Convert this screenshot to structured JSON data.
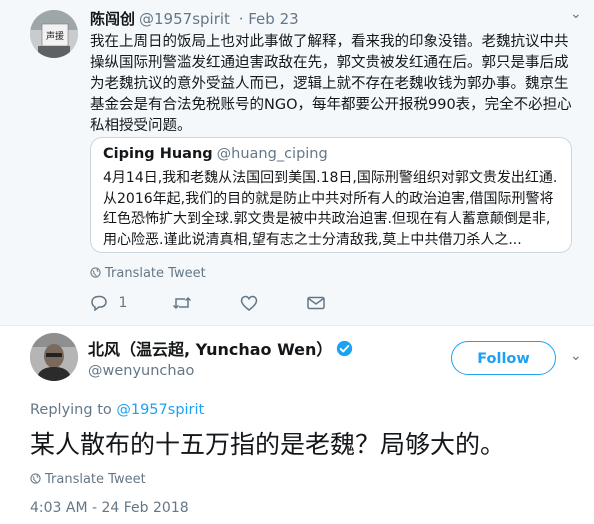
{
  "parent_tweet": {
    "name": "陈闯创",
    "handle": "@1957spirit",
    "time": "· Feb 23",
    "avatar_sign_text": "声援",
    "text": "我在上周日的饭局上也对此事做了解释，看来我的印象没错。老魏抗议中共操纵国际刑警滥发红通迫害政敌在先，郭文贵被发红通在后。郭只是事后成为老魏抗议的意外受益人而已，逻辑上就不存在老魏收钱为郭办事。魏京生基金会是有合法免税账号的NGO，每年都要公开报税990表，完全不必担心私相授受问题。",
    "quoted": {
      "name": "Ciping Huang",
      "handle": "@huang_ciping",
      "text": "4月14日,我和老魏从法国回到美国.18日,国际刑警组织对郭文贵发出红通.从2016年起,我们的目的就是防止中共对所有人的政治迫害,借国际刑警将红色恐怖扩大到全球.郭文贵是被中共政治迫害.但现在有人蓄意颠倒是非,用心险恶.谨此说清真相,望有志之士分清敌我,莫上中共借刀杀人之..."
    },
    "translate_label": "Translate Tweet",
    "reply_count": "1"
  },
  "main_tweet": {
    "name": "北风（温云超, Yunchao Wen）",
    "handle": "@wenyunchao",
    "follow_label": "Follow",
    "replying_prefix": "Replying to ",
    "replying_to": "@1957spirit",
    "text": "某人散布的十五万指的是老魏？局够大的。",
    "translate_label": "Translate Tweet",
    "timestamp": "4:03 AM - 24 Feb 2018"
  },
  "colors": {
    "accent": "#1da1f2",
    "muted": "#657786",
    "parent_bg": "#f5f8fa"
  }
}
